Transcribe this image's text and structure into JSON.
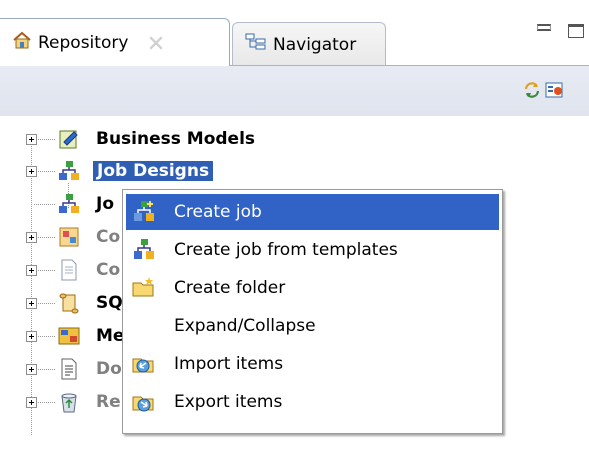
{
  "tabs": [
    {
      "label": "Repository",
      "icon": "house-icon",
      "active": true
    },
    {
      "label": "Navigator",
      "icon": "navigator-icon",
      "active": false
    }
  ],
  "tree": {
    "items": [
      {
        "label": "Business Models",
        "icon": "business-model-icon",
        "selected": false
      },
      {
        "label": "Job Designs",
        "icon": "job-designs-icon",
        "selected": true
      },
      {
        "label": "Jo",
        "icon": "job-icon",
        "selected": false
      },
      {
        "label": "Co",
        "icon": "contexts-icon",
        "selected": false
      },
      {
        "label": "Co",
        "icon": "code-icon",
        "selected": false
      },
      {
        "label": "SQ",
        "icon": "sql-icon",
        "selected": false
      },
      {
        "label": "Me",
        "icon": "metadata-icon",
        "selected": false
      },
      {
        "label": "Do",
        "icon": "documentation-icon",
        "selected": false
      },
      {
        "label": "Re",
        "icon": "recycle-bin-icon",
        "selected": false
      }
    ]
  },
  "context_menu": {
    "items": [
      {
        "label": "Create job",
        "icon": "create-job-icon",
        "highlighted": true
      },
      {
        "label": "Create job from templates",
        "icon": "job-template-icon",
        "highlighted": false
      },
      {
        "label": "Create folder",
        "icon": "folder-icon",
        "highlighted": false
      },
      {
        "label": "Expand/Collapse",
        "icon": "",
        "highlighted": false
      },
      {
        "label": "Import items",
        "icon": "import-icon",
        "highlighted": false
      },
      {
        "label": "Export items",
        "icon": "export-icon",
        "highlighted": false
      }
    ]
  },
  "colors": {
    "selection": "#2f5fb5",
    "menu_highlight": "#3063c5",
    "toolbar_bg": "#e3e8f0"
  }
}
